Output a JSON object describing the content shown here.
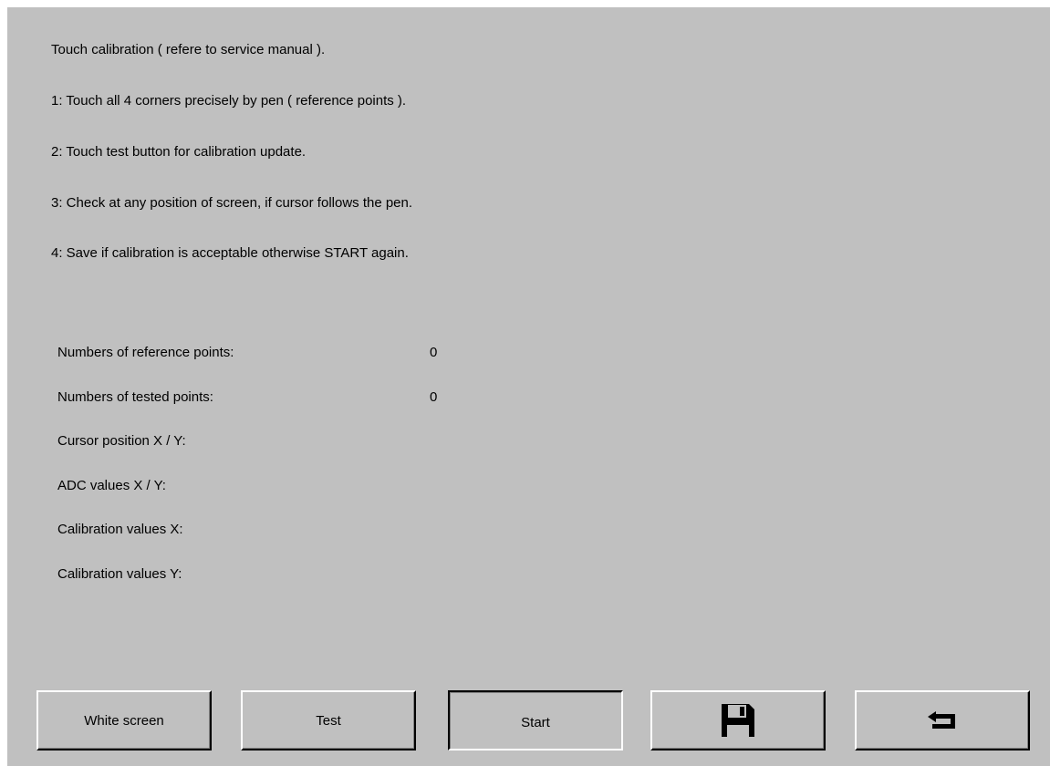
{
  "instructions": {
    "title": "Touch calibration ( refere to service manual ).",
    "step1": "1: Touch all 4 corners precisely by pen ( reference points ).",
    "step2": "2: Touch test button for calibration update.",
    "step3": "3: Check at any position of screen, if cursor follows  the pen.",
    "step4": "4: Save if calibration is acceptable otherwise START again."
  },
  "status": {
    "reference_points_label": "Numbers of reference points:",
    "reference_points_value": "0",
    "tested_points_label": "Numbers of tested points:",
    "tested_points_value": "0",
    "cursor_position_label": "Cursor position X / Y:",
    "adc_values_label": "ADC values X / Y:",
    "calibration_x_label": "Calibration values X:",
    "calibration_y_label": "Calibration values Y:"
  },
  "buttons": {
    "white_screen": "White screen",
    "test": "Test",
    "start": "Start",
    "save_icon": "floppy-disk-icon",
    "back_icon": "return-arrow-icon"
  },
  "colors": {
    "background": "#c0c0c0",
    "outer": "#ffffff"
  }
}
